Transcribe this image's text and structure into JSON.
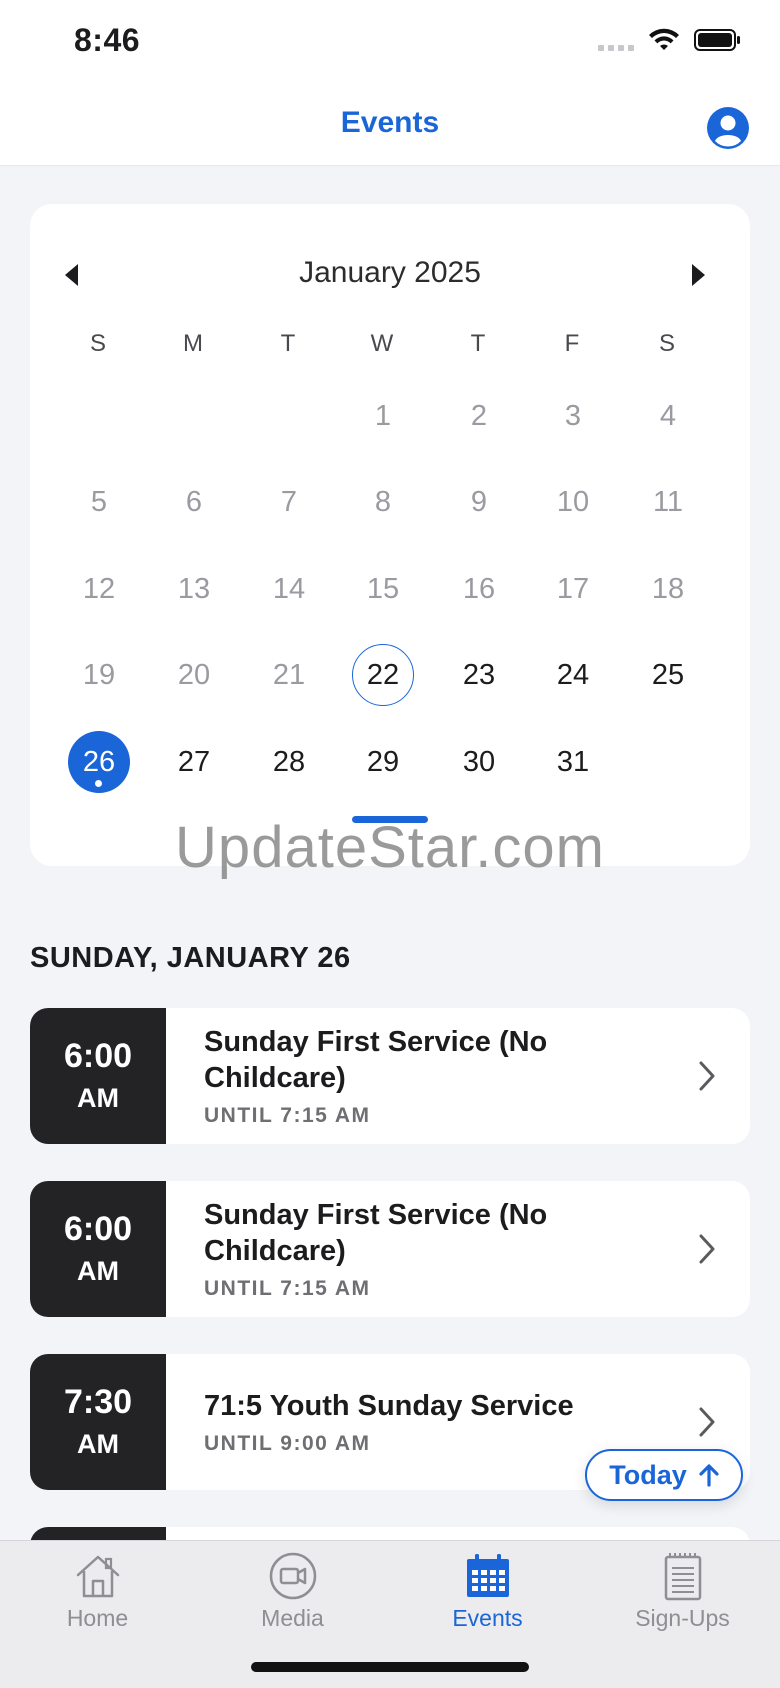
{
  "status_bar": {
    "time": "8:46"
  },
  "nav": {
    "title": "Events"
  },
  "calendar": {
    "month_label": "January 2025",
    "weekdays": [
      "S",
      "M",
      "T",
      "W",
      "T",
      "F",
      "S"
    ],
    "weeks": [
      [
        "",
        "",
        "",
        "1",
        "2",
        "3",
        "4"
      ],
      [
        "5",
        "6",
        "7",
        "8",
        "9",
        "10",
        "11"
      ],
      [
        "12",
        "13",
        "14",
        "15",
        "16",
        "17",
        "18"
      ],
      [
        "19",
        "20",
        "21",
        "22",
        "23",
        "24",
        "25"
      ],
      [
        "26",
        "27",
        "28",
        "29",
        "30",
        "31",
        ""
      ]
    ],
    "today": "22",
    "selected": "26"
  },
  "watermark": "UpdateStar.com",
  "events": {
    "section_title": "SUNDAY, JANUARY 26",
    "items": [
      {
        "time": "6:00",
        "period": "AM",
        "title": "Sunday First Service (No Childcare)",
        "until": "UNTIL 7:15 AM"
      },
      {
        "time": "6:00",
        "period": "AM",
        "title": "Sunday First Service (No Childcare)",
        "until": "UNTIL 7:15 AM"
      },
      {
        "time": "7:30",
        "period": "AM",
        "title": "71:5 Youth Sunday Service",
        "until": "UNTIL 9:00 AM"
      }
    ]
  },
  "today_button": {
    "label": "Today"
  },
  "tabs": [
    {
      "label": "Home",
      "icon": "home-icon"
    },
    {
      "label": "Media",
      "icon": "video-camera-icon"
    },
    {
      "label": "Events",
      "icon": "calendar-icon"
    },
    {
      "label": "Sign-Ups",
      "icon": "clipboard-icon"
    }
  ],
  "colors": {
    "accent": "#1a66d9",
    "time_block": "#232325",
    "background": "#f3f4f8"
  }
}
